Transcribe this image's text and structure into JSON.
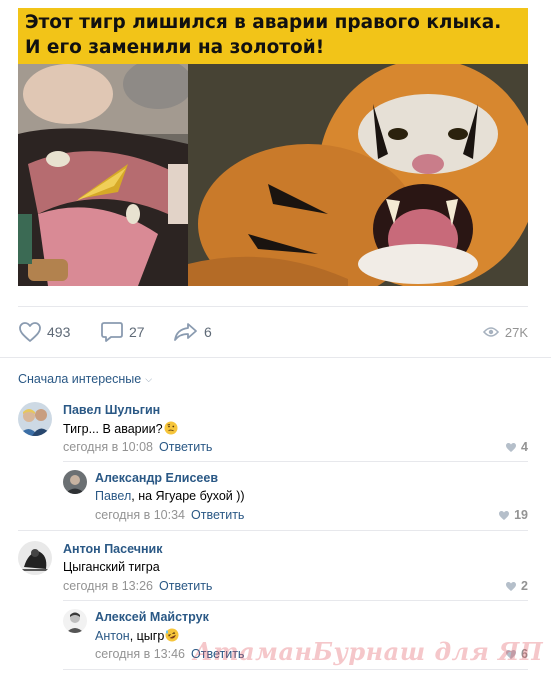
{
  "post": {
    "banner_line1": "Этот тигр лишился в аварии правого клыка.",
    "banner_line2": "И его заменили на золотой!"
  },
  "actions": {
    "likes": "493",
    "comments": "27",
    "shares": "6",
    "views": "27K"
  },
  "comments_sort": {
    "label": "Сначала интересные"
  },
  "comments": [
    {
      "author": "Павел Шульгин",
      "text": "Тигр... В аварии?",
      "time": "сегодня в 10:08",
      "reply_label": "Ответить",
      "likes": "4"
    },
    {
      "author": "Александр Елисеев",
      "mention": "Павел",
      "text": ", на Ягуаре бухой ))",
      "time": "сегодня в 10:34",
      "reply_label": "Ответить",
      "likes": "19"
    },
    {
      "author": "Антон Пасечник",
      "text": "Цыганский тигра",
      "time": "сегодня в 13:26",
      "reply_label": "Ответить",
      "likes": "2"
    },
    {
      "author": "Алексей Майструк",
      "mention": "Антон",
      "text": ", цыгр",
      "time": "сегодня в 13:46",
      "reply_label": "Ответить",
      "likes": "6"
    }
  ],
  "watermark": "АтаманБурнаш для ЯП",
  "colors": {
    "link": "#2a5885",
    "meta": "#939393",
    "banner": "#f2c418",
    "divider": "#e7e8ec"
  }
}
